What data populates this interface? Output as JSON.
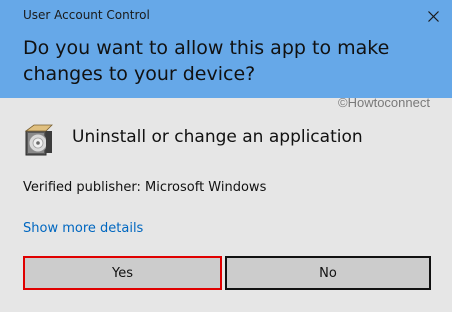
{
  "window": {
    "title": "User Account Control"
  },
  "prompt": {
    "question": "Do you want to allow this app to make changes to your device?"
  },
  "watermark": "©Howtoconnect",
  "app": {
    "icon": "installer-cd-icon",
    "name": "Uninstall or change an application"
  },
  "publisher": "Verified publisher: Microsoft Windows",
  "details_link": "Show more details",
  "buttons": {
    "yes": "Yes",
    "no": "No"
  },
  "colors": {
    "header_bg": "#66a8e8",
    "body_bg": "#e6e6e6",
    "link": "#0067c0",
    "button_bg": "#cccccc",
    "highlight_border": "#e00000"
  }
}
